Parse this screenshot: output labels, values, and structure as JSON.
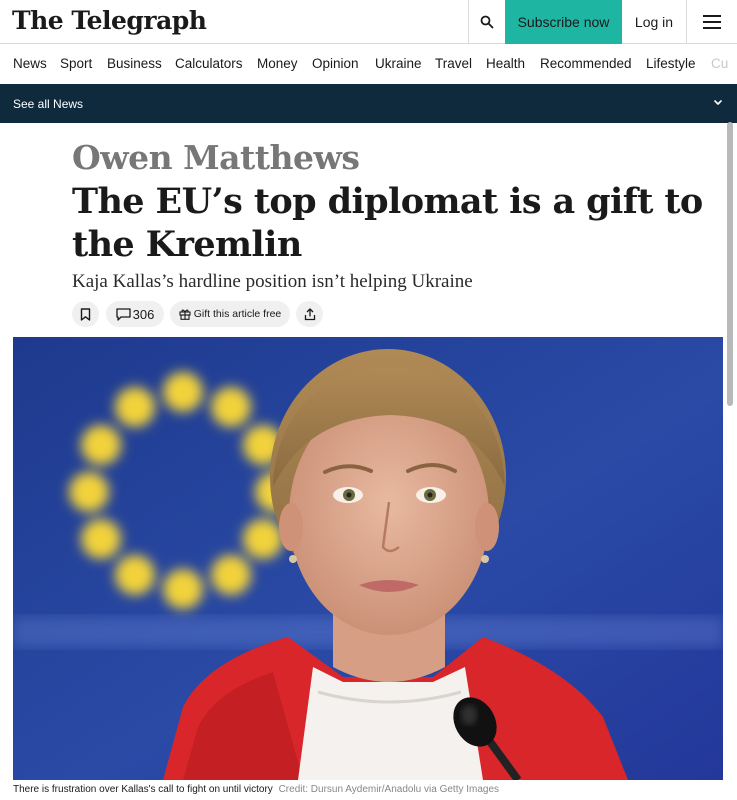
{
  "header": {
    "logo": "The Telegraph",
    "subscribe_label": "Subscribe now",
    "login_label": "Log in",
    "accent_color": "#1fb5a3"
  },
  "nav": {
    "items": [
      "News",
      "Sport",
      "Business",
      "Calculators",
      "Money",
      "Opinion",
      "Ukraine",
      "Travel",
      "Health",
      "Recommended",
      "Lifestyle",
      "Cu"
    ]
  },
  "section_bar": {
    "label": "See all News",
    "background": "#0e2a3c"
  },
  "article": {
    "author": "Owen Matthews",
    "headline": "The EU’s top diplomat is a gift to the Kremlin",
    "standfirst": "Kaja Kallas’s hardline position isn’t helping Ukraine",
    "comment_count": "306",
    "gift_label": "Gift this article free",
    "caption": "There is frustration over Kallas's call to fight on until victory",
    "credit": "Credit: Dursun Aydemir/Anadolu via Getty Images"
  },
  "icons": {
    "search": "search-icon",
    "menu": "hamburger-menu-icon",
    "chevron": "chevron-down-icon",
    "bookmark": "bookmark-icon",
    "comments": "comment-icon",
    "gift": "gift-icon",
    "share": "share-icon"
  }
}
